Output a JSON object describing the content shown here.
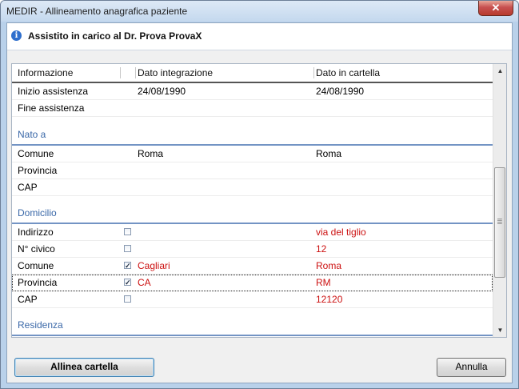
{
  "window": {
    "title": "MEDIR - Allineamento anagrafica paziente",
    "close_glyph": "✕"
  },
  "header": {
    "title": "Assistito in carico al Dr. Prova ProvaX",
    "icon": "info-icon",
    "icon_glyph": "i"
  },
  "grid": {
    "columns": [
      "Informazione",
      "Dato integrazione",
      "Dato in cartella"
    ],
    "rows_top": [
      {
        "label": "Inizio assistenza",
        "integrazione": "24/08/1990",
        "cartella": "24/08/1990"
      },
      {
        "label": "Fine assistenza",
        "integrazione": "",
        "cartella": ""
      }
    ],
    "groups": {
      "nato_a": "Nato a",
      "domicilio": "Domicilio",
      "residenza": "Residenza"
    },
    "nato_a_rows": [
      {
        "label": "Comune",
        "integrazione": "Roma",
        "cartella": "Roma"
      },
      {
        "label": "Provincia",
        "integrazione": "",
        "cartella": ""
      },
      {
        "label": "CAP",
        "integrazione": "",
        "cartella": ""
      }
    ],
    "domicilio_rows": [
      {
        "label": "Indirizzo",
        "checked": false,
        "integrazione": "",
        "cartella": "via del tiglio"
      },
      {
        "label": "N° civico",
        "checked": false,
        "integrazione": "",
        "cartella": "12"
      },
      {
        "label": "Comune",
        "checked": true,
        "integrazione": "Cagliari",
        "cartella": "Roma"
      },
      {
        "label": "Provincia",
        "checked": true,
        "integrazione": "CA",
        "cartella": "RM",
        "selected": true
      },
      {
        "label": "CAP",
        "checked": false,
        "integrazione": "",
        "cartella": "12120"
      }
    ],
    "colors": {
      "changed": "#cc1111",
      "group": "#3a68a8"
    }
  },
  "buttons": {
    "align": "Allinea cartella",
    "cancel": "Annulla"
  }
}
